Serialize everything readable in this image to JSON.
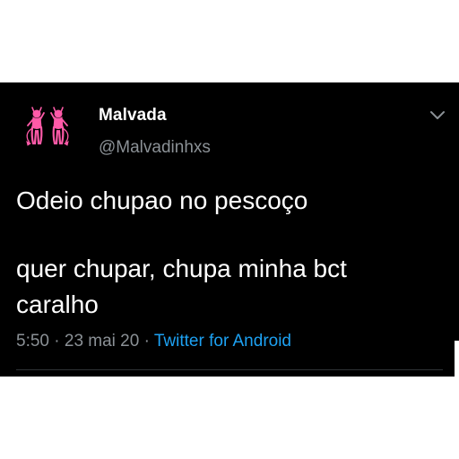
{
  "tweet": {
    "author_name": "Malvada",
    "author_handle": "@Malvadinhxs",
    "text_line_1": "Odeio chupao no pescoço",
    "text_line_2": "quer chupar, chupa minha bct",
    "text_line_3": "caralho",
    "time": "5:50",
    "separator_1": " · ",
    "date": "23 mai 20",
    "separator_2": " · ",
    "source": "Twitter for Android"
  },
  "icons": {
    "avatar": "pink-devil-girls-avatar-icon",
    "menu": "chevron-down-icon"
  },
  "colors": {
    "background": "#000000",
    "text": "#ffffff",
    "secondary_text": "#8b9196",
    "link": "#1da1f2",
    "avatar_pink": "#ff5aa8"
  }
}
